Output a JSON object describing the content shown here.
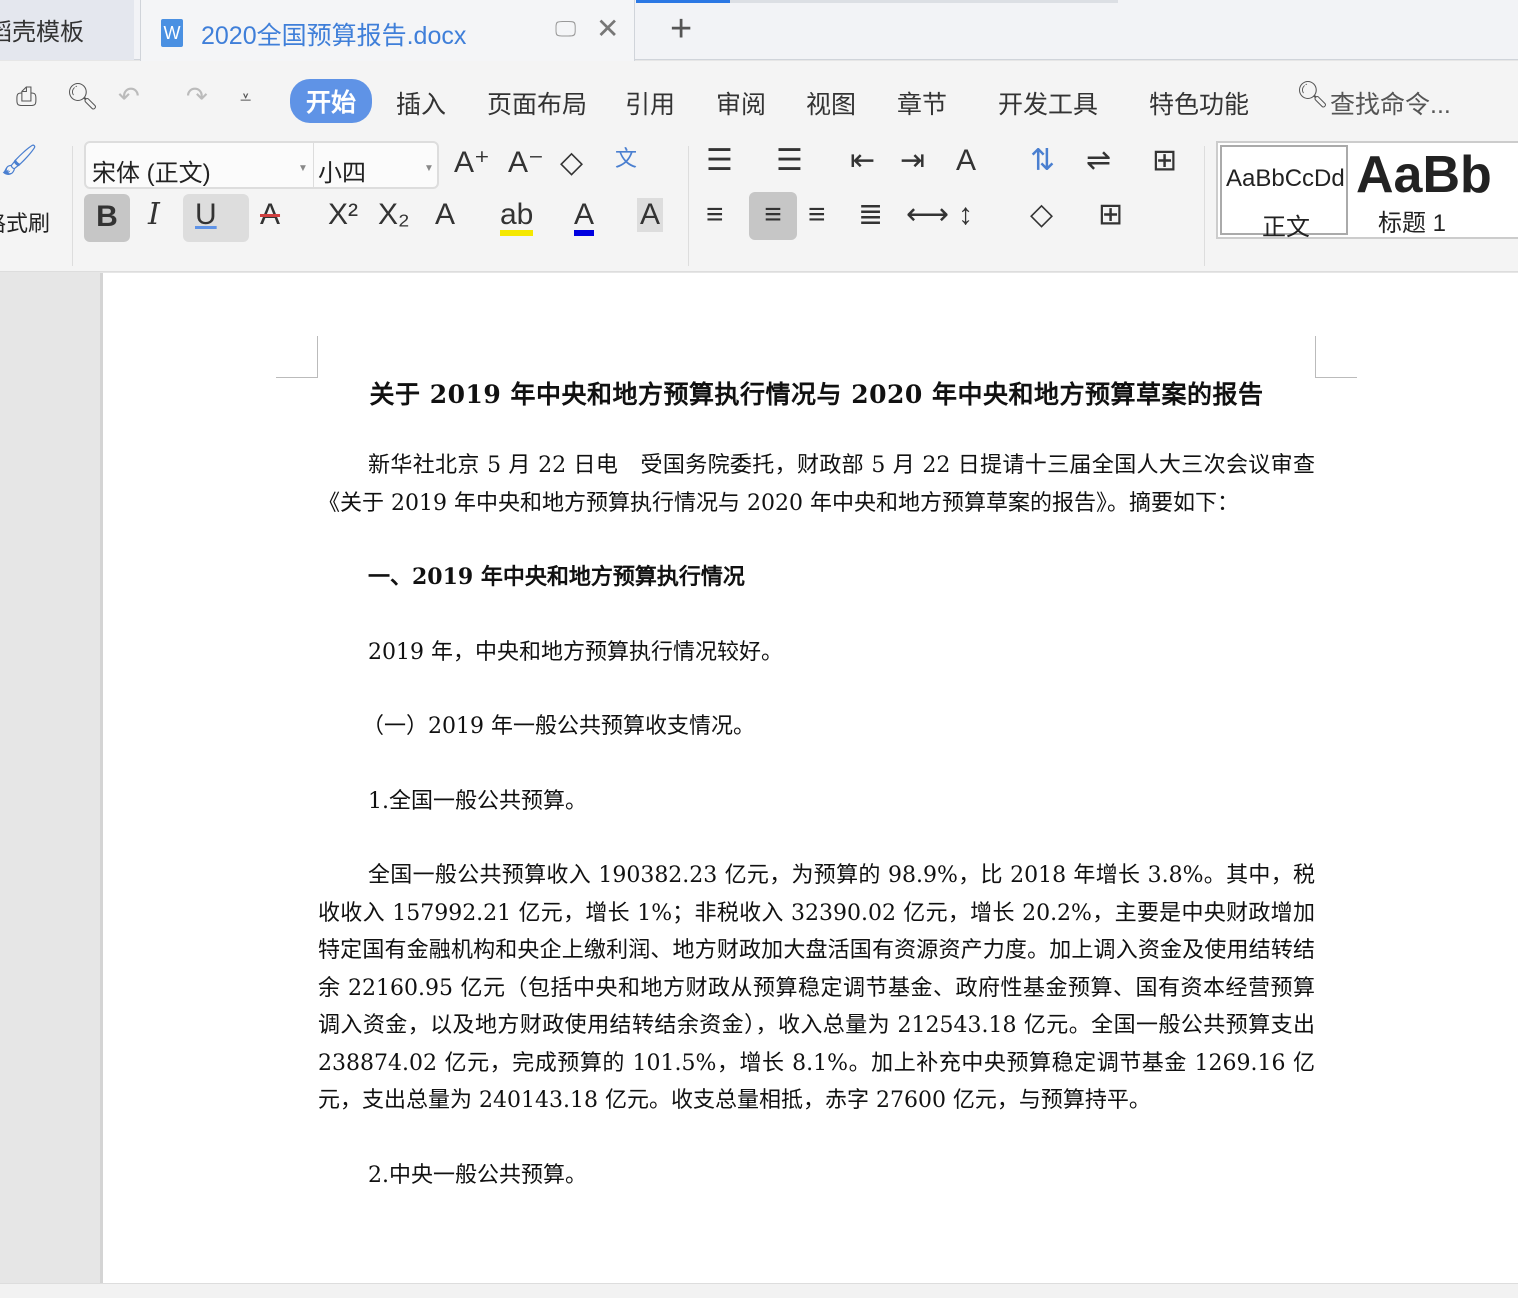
{
  "tabs": {
    "prev_label": "稻壳模板",
    "active_label": "2020全国预算报告.docx",
    "new_tab": "+",
    "active_icon": "W"
  },
  "menu": {
    "items": [
      "开始",
      "插入",
      "页面布局",
      "引用",
      "审阅",
      "视图",
      "章节",
      "开发工具",
      "特色功能"
    ],
    "search_placeholder": "查找命令..."
  },
  "ribbon": {
    "format_painter": "格式刷",
    "font_name": "宋体 (正文)",
    "font_size": "小四",
    "styles": [
      {
        "preview": "AaBbCcDd",
        "label": "正文"
      },
      {
        "preview": "AaBb",
        "label": "标题 1"
      }
    ],
    "colors": {
      "highlight": "#f5e800",
      "font_color": "#0000e0",
      "strike": "#d04040",
      "accent": "#5f93e6"
    }
  },
  "document": {
    "title": "关于 2019 年中央和地方预算执行情况与 2020 年中央和地方预算草案的报告",
    "paragraphs": [
      {
        "text": "新华社北京 5 月 22 日电　受国务院委托，财政部 5 月 22 日提请十三届全国人大三次会议审查《关于 2019 年中央和地方预算执行情况与 2020 年中央和地方预算草案的报告》。摘要如下：",
        "bold": false
      },
      {
        "text": "一、2019 年中央和地方预算执行情况",
        "bold": true
      },
      {
        "text": "2019 年，中央和地方预算执行情况较好。",
        "bold": false
      },
      {
        "text": "（一）2019 年一般公共预算收支情况。",
        "bold": false
      },
      {
        "text": "1.全国一般公共预算。",
        "bold": false
      },
      {
        "text": "全国一般公共预算收入 190382.23 亿元，为预算的 98.9%，比 2018 年增长 3.8%。其中，税收收入 157992.21 亿元，增长 1%；非税收入 32390.02 亿元，增长 20.2%，主要是中央财政增加特定国有金融机构和央企上缴利润、地方财政加大盘活国有资源资产力度。加上调入资金及使用结转结余 22160.95 亿元（包括中央和地方财政从预算稳定调节基金、政府性基金预算、国有资本经营预算调入资金，以及地方财政使用结转结余资金），收入总量为 212543.18 亿元。全国一般公共预算支出 238874.02 亿元，完成预算的 101.5%，增长 8.1%。加上补充中央预算稳定调节基金 1269.16 亿元，支出总量为 240143.18 亿元。收支总量相抵，赤字 27600 亿元，与预算持平。",
        "bold": false
      },
      {
        "text": "2.中央一般公共预算。",
        "bold": false
      }
    ]
  }
}
